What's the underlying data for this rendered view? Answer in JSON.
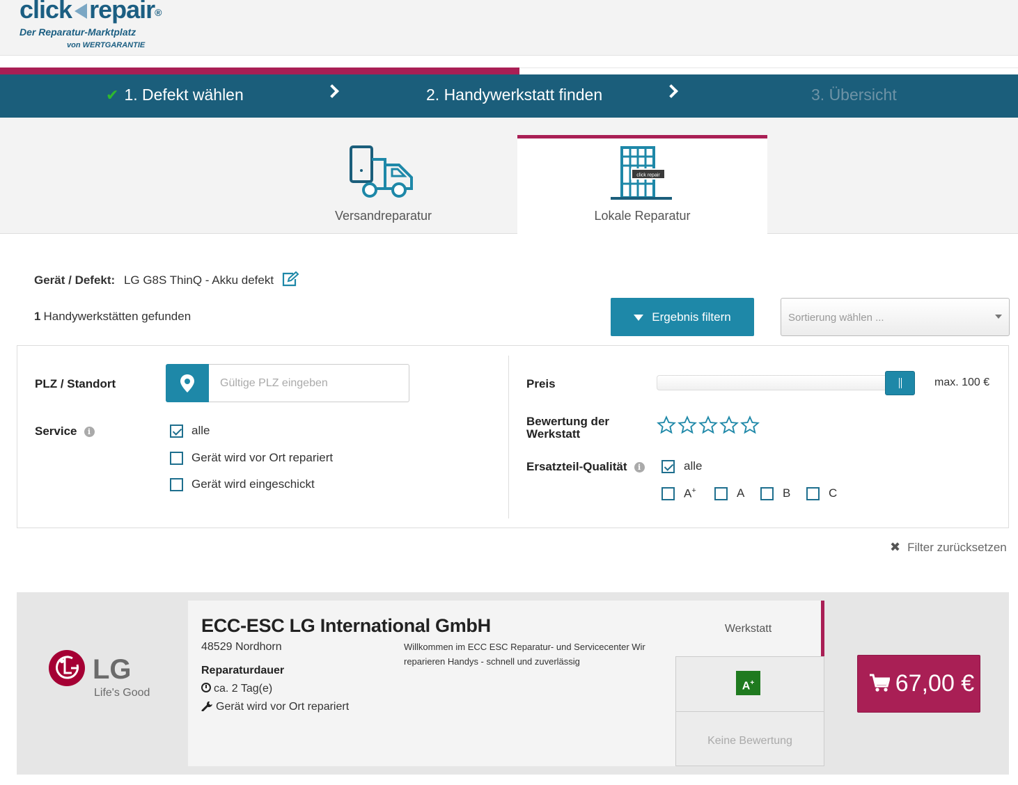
{
  "logo": {
    "brand_left": "click",
    "brand_right": "repair",
    "reg": "®",
    "tagline": "Der Reparatur-Marktplatz",
    "byline": "von WERTGARANTIE"
  },
  "progress": {
    "fraction": 0.51
  },
  "steps": [
    {
      "label": "1. Defekt wählen",
      "state": "done"
    },
    {
      "label": "2. Handywerkstatt finden",
      "state": "active"
    },
    {
      "label": "3. Übersicht",
      "state": "inactive"
    }
  ],
  "tabs": [
    {
      "label": "Versandreparatur",
      "icon": "truck-phone-icon",
      "active": false
    },
    {
      "label": "Lokale Reparatur",
      "icon": "building-icon",
      "active": true,
      "sign": "click repair"
    }
  ],
  "device": {
    "label": "Gerät / Defekt:",
    "value": "LG G8S ThinQ - Akku defekt"
  },
  "results_found": {
    "count": "1",
    "text": "Handywerkstätten gefunden"
  },
  "filter_button": "Ergebnis filtern",
  "sort": {
    "placeholder": "Sortierung wählen ..."
  },
  "filters": {
    "plz_label": "PLZ / Standort",
    "plz_placeholder": "Gültige PLZ eingeben",
    "plz_value": "",
    "service_label": "Service",
    "service_options": [
      {
        "label": "alle",
        "checked": true
      },
      {
        "label": "Gerät wird vor Ort repariert",
        "checked": false
      },
      {
        "label": "Gerät wird eingeschickt",
        "checked": false
      }
    ],
    "price_label": "Preis",
    "price_value": "max. 100 €",
    "price_fraction": 1.0,
    "rating_label_1": "Bewertung der",
    "rating_label_2": "Werkstatt",
    "rating_stars": 0,
    "rating_max": 5,
    "quality_label": "Ersatzteil-Qualität",
    "quality_all": {
      "label": "alle",
      "checked": true
    },
    "quality_options": [
      {
        "label": "A",
        "sup": "+",
        "checked": false
      },
      {
        "label": "A",
        "sup": "",
        "checked": false
      },
      {
        "label": "B",
        "sup": "",
        "checked": false
      },
      {
        "label": "C",
        "sup": "",
        "checked": false
      }
    ]
  },
  "reset_label": "Filter zurücksetzen",
  "result": {
    "logo_brand": "LG",
    "logo_slogan": "Life's Good",
    "name": "ECC-ESC LG International GmbH",
    "city": "48529 Nordhorn",
    "description": "Willkommen im ECC ESC Reparatur- und Servicecenter Wir reparieren Handys - schnell und zuverlässig",
    "duration_heading": "Reparaturdauer",
    "duration": "ca. 2 Tag(e)",
    "service": "Gerät wird vor Ort repariert",
    "type_label": "Werkstatt",
    "quality_badge": "A",
    "quality_badge_sup": "+",
    "rating_text": "Keine Bewertung",
    "price": "67,00 €"
  },
  "colors": {
    "brand_blue": "#1b5e7b",
    "accent_teal": "#1e88a8",
    "accent_magenta": "#a91f55",
    "check_green": "#2eb82e",
    "badge_green": "#1f7a1f"
  }
}
